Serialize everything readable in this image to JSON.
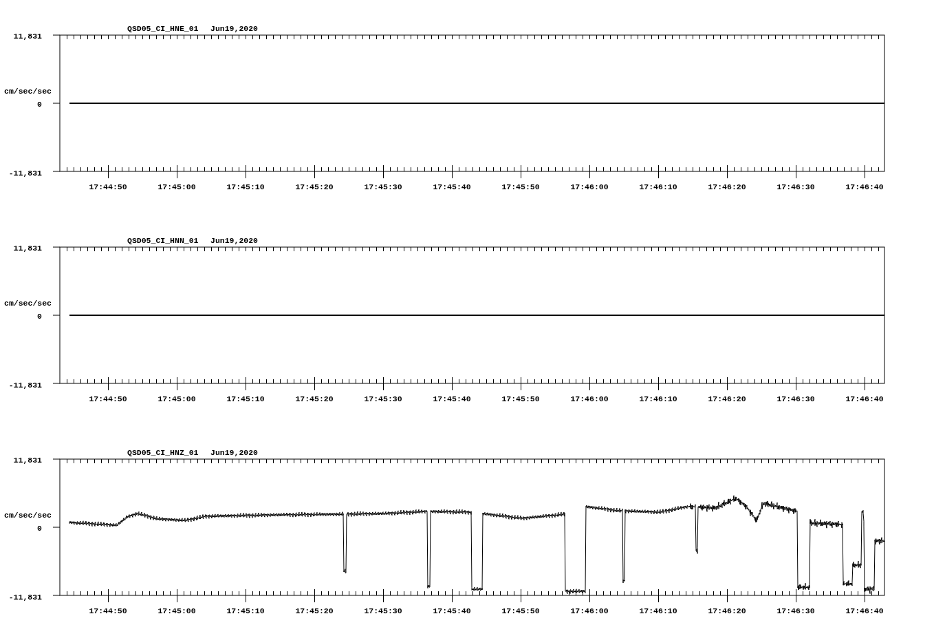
{
  "panels": [
    {
      "station": "QSD05_CI_HNE_01",
      "date": "Jun19,2020",
      "units": "cm/sec/sec",
      "y_labels": [
        "11,831",
        "0",
        "-11,831"
      ],
      "x_labels": [
        "17:44:50",
        "17:45:00",
        "17:45:10",
        "17:45:20",
        "17:45:30",
        "17:45:40",
        "17:45:50",
        "17:46:00",
        "17:46:10",
        "17:46:20",
        "17:46:30",
        "17:46:40"
      ],
      "trace": {
        "kind": "flat"
      }
    },
    {
      "station": "QSD05_CI_HNN_01",
      "date": "Jun19,2020",
      "units": "cm/sec/sec",
      "y_labels": [
        "11,831",
        "0",
        "-11,831"
      ],
      "x_labels": [
        "17:44:50",
        "17:45:00",
        "17:45:10",
        "17:45:20",
        "17:45:30",
        "17:45:40",
        "17:45:50",
        "17:46:00",
        "17:46:10",
        "17:46:20",
        "17:46:30",
        "17:46:40"
      ],
      "trace": {
        "kind": "flat"
      }
    },
    {
      "station": "QSD05_CI_HNZ_01",
      "date": "Jun19,2020",
      "units": "cm/sec/sec",
      "y_labels": [
        "11,831",
        "0",
        "-11,831"
      ],
      "x_labels": [
        "17:44:50",
        "17:45:00",
        "17:45:10",
        "17:45:20",
        "17:45:30",
        "17:45:40",
        "17:45:50",
        "17:46:00",
        "17:46:10",
        "17:46:20",
        "17:46:30",
        "17:46:40"
      ],
      "trace": {
        "kind": "waveform"
      }
    }
  ]
}
